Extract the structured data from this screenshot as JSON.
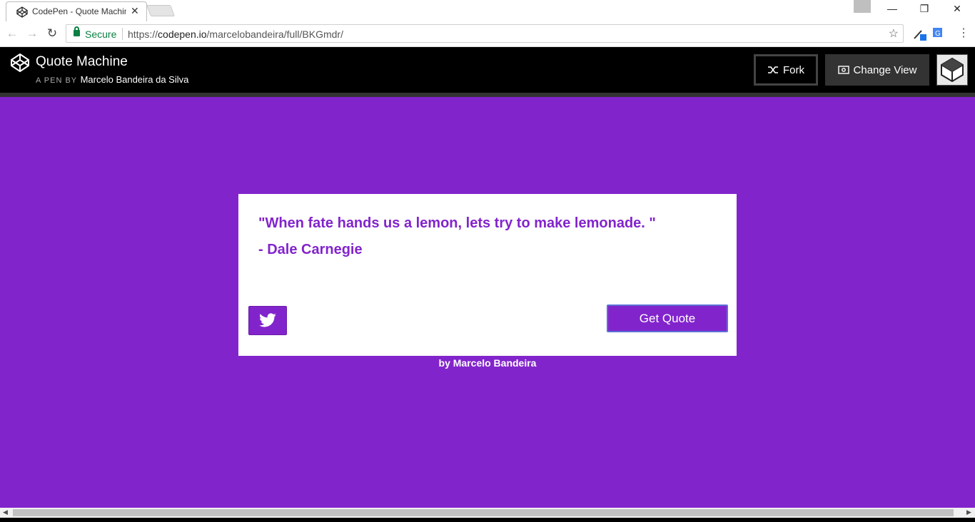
{
  "browser": {
    "tab_title": "CodePen - Quote Machine",
    "tab_close": "✕",
    "secure_label": "Secure",
    "url_scheme": "https://",
    "url_host": "codepen.io",
    "url_path": "/marcelobandeira/full/BKGmdr/"
  },
  "codepen": {
    "title": "Quote Machine",
    "byline_prefix": "A PEN BY",
    "author": "Marcelo Bandeira da Silva",
    "fork_label": "Fork",
    "change_view_label": "Change View"
  },
  "quote": {
    "text": "\"When fate hands us a lemon, lets try to make lemonade. \"",
    "author": "- Dale Carnegie",
    "get_quote_label": "Get Quote"
  },
  "footer": {
    "credit": "by Marcelo Bandeira"
  },
  "colors": {
    "accent": "#8224cc",
    "header": "#000000"
  },
  "icons": [
    "codepen-icon",
    "lock-icon",
    "star-icon",
    "fork-icon",
    "eye-icon",
    "twitter-icon"
  ]
}
